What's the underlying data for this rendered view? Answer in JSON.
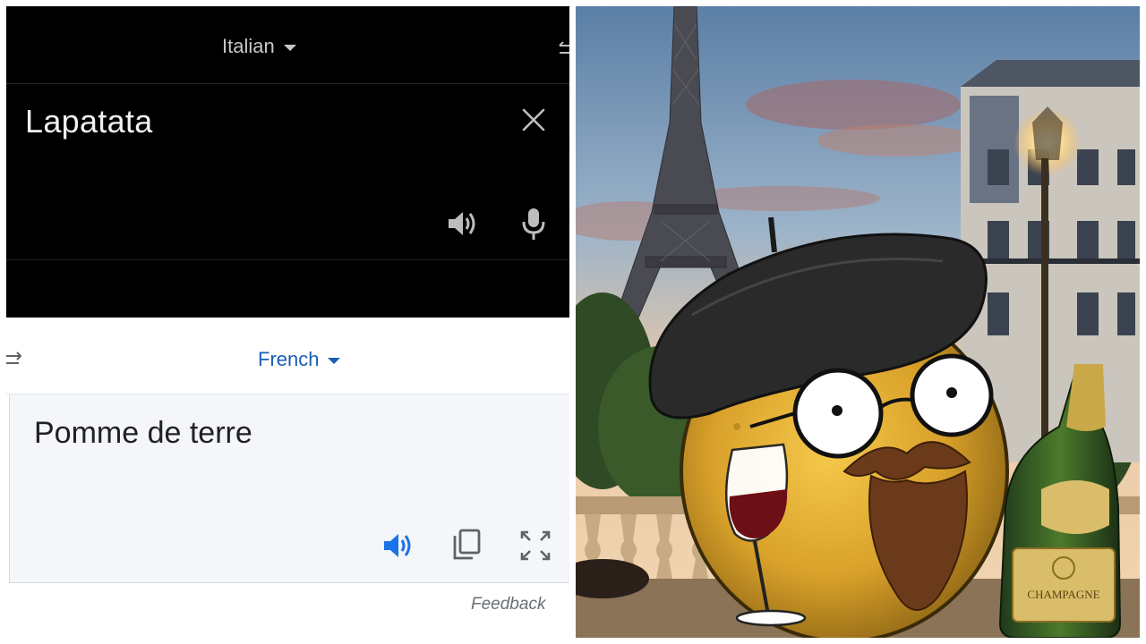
{
  "top_panel": {
    "source_language": "Italian",
    "source_text": "Lapatata"
  },
  "bottom_panel": {
    "target_language": "French",
    "translated_text": "Pomme de terre",
    "feedback_label": "Feedback"
  },
  "illustration": {
    "bottle_label": "CHAMPAGNE"
  },
  "colors": {
    "dark_bg": "#000000",
    "accent_blue": "#1a5fb4",
    "result_bg": "#f4f6f9"
  },
  "icons": [
    "chevron-down-icon",
    "swap-icon",
    "close-icon",
    "speaker-icon",
    "microphone-icon",
    "copy-icon",
    "fullscreen-icon"
  ]
}
